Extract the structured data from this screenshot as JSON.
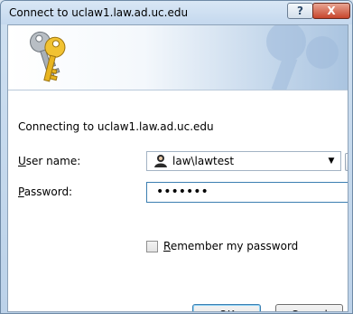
{
  "window": {
    "title": "Connect to uclaw1.law.ad.uc.edu",
    "help_label": "?",
    "close_label": "X"
  },
  "dialog": {
    "connecting_text": "Connecting to uclaw1.law.ad.uc.edu",
    "user_label_key": "U",
    "user_label_rest": "ser name:",
    "password_label_key": "P",
    "password_label_rest": "assword:",
    "user_value": "law\\lawtest",
    "password_value": "•••••••",
    "remember_key": "R",
    "remember_rest": "emember my password",
    "remember_checked": false,
    "browse_label": "...",
    "ok_label": "OK",
    "cancel_label": "Cancel"
  },
  "icons": {
    "banner": "keys-icon",
    "user": "user-icon",
    "dropdown": "chevron-down-icon"
  },
  "colors": {
    "accent": "#3c7fb1",
    "close": "#c7452c"
  }
}
